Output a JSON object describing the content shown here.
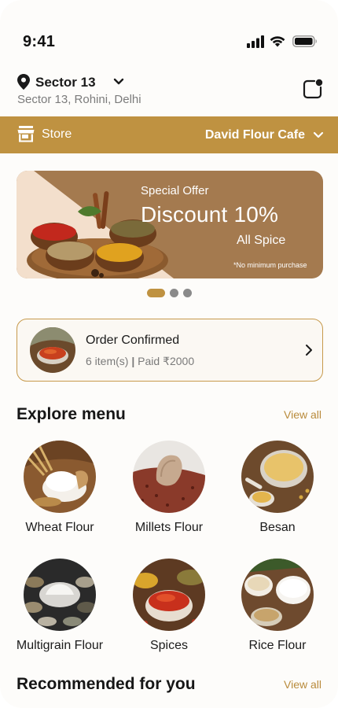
{
  "status": {
    "time": "9:41"
  },
  "location": {
    "name": "Sector 13",
    "address": "Sector 13, Rohini, Delhi"
  },
  "store": {
    "label": "Store",
    "selected": "David Flour Cafe"
  },
  "banner": {
    "title": "Special Offer",
    "headline": "Discount 10%",
    "subtitle": "All Spice",
    "note": "*No minimum purchase",
    "pages": 3,
    "active_page": 1
  },
  "order": {
    "title": "Order Confirmed",
    "items": "6 item(s)",
    "separator": "|",
    "paid": "Paid ₹2000"
  },
  "explore": {
    "title": "Explore menu",
    "view_all": "View all",
    "categories": [
      {
        "label": "Wheat Flour"
      },
      {
        "label": "Millets Flour"
      },
      {
        "label": "Besan"
      },
      {
        "label": "Multigrain Flour"
      },
      {
        "label": "Spices"
      },
      {
        "label": "Rice Flour"
      }
    ]
  },
  "recommended": {
    "title": "Recommended for you",
    "view_all": "View all"
  },
  "colors": {
    "accent": "#bf9241",
    "banner": "#a47a4f",
    "cream": "#f3dfcc"
  }
}
